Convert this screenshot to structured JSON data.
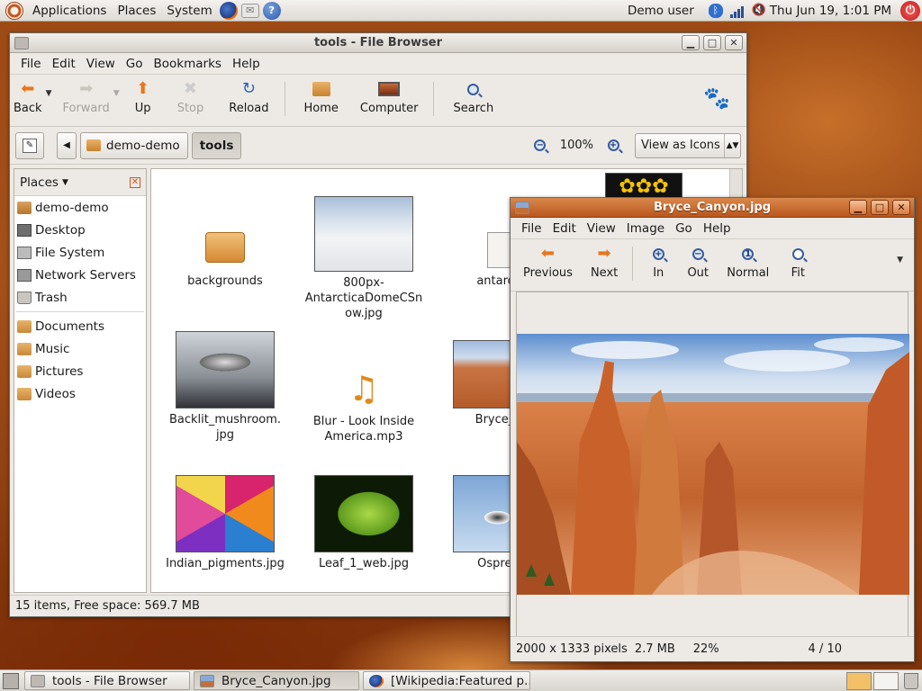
{
  "top_panel": {
    "menus": [
      "Applications",
      "Places",
      "System"
    ],
    "user": "Demo user",
    "clock": "Thu Jun 19,  1:01 PM"
  },
  "file_browser": {
    "title": "tools - File Browser",
    "menus": [
      "File",
      "Edit",
      "View",
      "Go",
      "Bookmarks",
      "Help"
    ],
    "toolbar": {
      "back": "Back",
      "forward": "Forward",
      "up": "Up",
      "stop": "Stop",
      "reload": "Reload",
      "home": "Home",
      "computer": "Computer",
      "search": "Search"
    },
    "location": {
      "crumbs": [
        "demo-demo",
        "tools"
      ],
      "zoom": "100%",
      "view_mode": "View as Icons"
    },
    "sidebar": {
      "heading": "Places",
      "places": [
        "demo-demo",
        "Desktop",
        "File System",
        "Network Servers",
        "Trash"
      ],
      "bookmarks": [
        "Documents",
        "Music",
        "Pictures",
        "Videos"
      ]
    },
    "files": [
      {
        "name": "backgrounds"
      },
      {
        "name": "800px-AntarcticaDomeCSnow.jpg",
        "lines": [
          "800px-",
          "AntarcticaDomeCSn",
          "ow.jpg"
        ]
      },
      {
        "name": "antarctic",
        "lines": [
          "antarctic"
        ]
      },
      {
        "name": "Backlit_mushroom.jpg",
        "lines": [
          "Backlit_mushroom.",
          "jpg"
        ]
      },
      {
        "name": "Blur - Look Inside America.mp3",
        "lines": [
          "Blur - Look Inside",
          "America.mp3"
        ]
      },
      {
        "name": "Bryce_Ca",
        "lines": [
          "Bryce_Ca"
        ]
      },
      {
        "name": "Indian_pigments.jpg"
      },
      {
        "name": "Leaf_1_web.jpg"
      },
      {
        "name": "OspreyN",
        "lines": [
          "OspreyN"
        ]
      }
    ],
    "status": "15 items, Free space: 569.7 MB"
  },
  "image_viewer": {
    "title": "Bryce_Canyon.jpg",
    "menus": [
      "File",
      "Edit",
      "View",
      "Image",
      "Go",
      "Help"
    ],
    "toolbar": {
      "previous": "Previous",
      "next": "Next",
      "in": "In",
      "out": "Out",
      "normal": "Normal",
      "fit": "Fit"
    },
    "status": {
      "dimensions": "2000 x 1333 pixels",
      "size": "2.7 MB",
      "zoom": "22%",
      "position": "4 / 10"
    }
  },
  "taskbar": {
    "tasks": [
      "tools - File Browser",
      "Bryce_Canyon.jpg",
      "[Wikipedia:Featured p..."
    ]
  },
  "colors": {
    "accent": "#d0651f",
    "active_title": "#b9561c",
    "desktop": "#9e4a14"
  }
}
